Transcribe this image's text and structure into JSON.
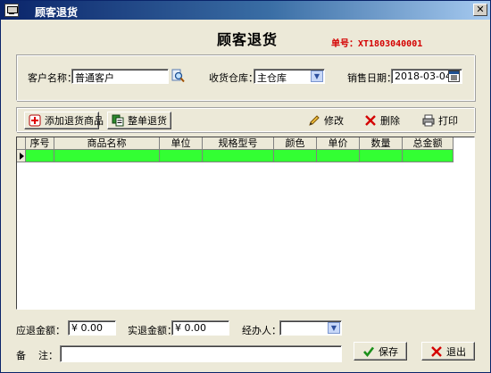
{
  "window": {
    "title": "顾客退货",
    "close_glyph": "✕"
  },
  "form": {
    "title": "顾客退货",
    "order_no": "单号：XT1803040001"
  },
  "header": {
    "customer_label": "客户名称：",
    "customer_value": "普通客户",
    "warehouse_label": "收货仓库：",
    "warehouse_value": "主仓库",
    "date_label": "销售日期：",
    "date_value": "2018-03-04"
  },
  "toolbar": {
    "add_item": "添加退货商品",
    "whole_return": "整单退货",
    "edit": "修改",
    "delete": "删除",
    "print": "打印"
  },
  "grid": {
    "columns": [
      "序号",
      "商品名称",
      "单位",
      "规格型号",
      "颜色",
      "单价",
      "数量",
      "总金额"
    ]
  },
  "footer": {
    "due_label": "应退金额：",
    "due_value": "¥ 0.00",
    "actual_label": "实退金额：",
    "actual_value": "¥ 0.00",
    "handler_label": "经办人：",
    "handler_value": "",
    "note_label": "备    注：",
    "note_value": "",
    "save": "保存",
    "exit": "退出"
  },
  "colors": {
    "selected_row": "#33ff33",
    "order_no": "#d40000",
    "title_bar": "#0a246a"
  }
}
